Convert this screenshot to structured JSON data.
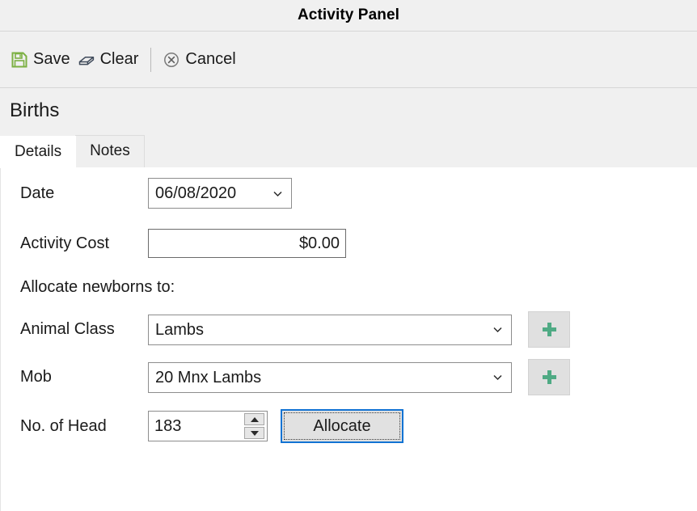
{
  "window": {
    "title": "Activity Panel"
  },
  "toolbar": {
    "save_label": "Save",
    "clear_label": "Clear",
    "cancel_label": "Cancel",
    "save_icon": "floppy-disk-icon",
    "clear_icon": "eraser-icon",
    "cancel_icon": "circle-x-icon",
    "save_icon_color": "#7cb043",
    "clear_icon_color": "#3f4a5a",
    "cancel_icon_color": "#7a7a7a"
  },
  "section": {
    "heading": "Births"
  },
  "tabs": [
    {
      "label": "Details",
      "active": true
    },
    {
      "label": "Notes",
      "active": false
    }
  ],
  "form": {
    "date": {
      "label": "Date",
      "value": "06/08/2020",
      "chevron_icon": "chevron-down-icon"
    },
    "activity_cost": {
      "label": "Activity Cost",
      "value": "$0.00"
    },
    "allocate_heading": "Allocate newborns to:",
    "animal_class": {
      "label": "Animal Class",
      "value": "Lambs",
      "chevron_icon": "chevron-down-icon",
      "add_icon": "plus-icon"
    },
    "mob": {
      "label": "Mob",
      "value": "20 Mnx Lambs",
      "chevron_icon": "chevron-down-icon",
      "add_icon": "plus-icon"
    },
    "no_of_head": {
      "label": "No. of Head",
      "value": "183",
      "spinner_up_icon": "triangle-up-icon",
      "spinner_down_icon": "triangle-down-icon"
    },
    "allocate_button": {
      "label": "Allocate",
      "focused": true
    }
  },
  "colors": {
    "panel_background": "#f0f0f0",
    "content_background": "#ffffff",
    "accent_green": "#4faa84",
    "focus_blue": "#1273d3"
  }
}
